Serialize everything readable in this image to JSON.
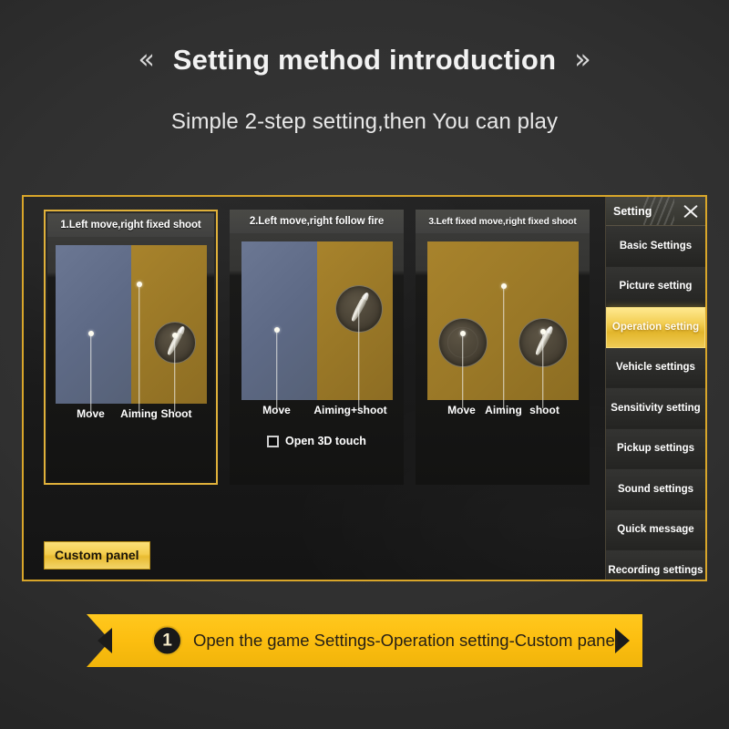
{
  "header": {
    "title": "Setting method introduction",
    "subtitle": "Simple 2-step setting,then You can play",
    "left_chevron": "«",
    "right_chevron": "»"
  },
  "panels": [
    {
      "title": "1.Left move,right fixed shoot",
      "selected": true,
      "layout": "split",
      "labels": [
        "Move",
        "Aiming",
        "Shoot"
      ]
    },
    {
      "title": "2.Left move,right follow fire",
      "selected": false,
      "layout": "split",
      "labels": [
        "Move",
        "Aiming+shoot"
      ],
      "checkbox": {
        "label": "Open 3D touch",
        "checked": false
      }
    },
    {
      "title": "3.Left fixed move,right fixed shoot",
      "selected": false,
      "layout": "full",
      "labels": [
        "Move",
        "Aiming",
        "shoot"
      ]
    }
  ],
  "custom_panel_button": "Custom panel",
  "sidebar": {
    "title": "Setting",
    "close_icon": "close-icon",
    "items": [
      {
        "label": "Basic Settings",
        "active": false
      },
      {
        "label": "Picture setting",
        "active": false
      },
      {
        "label": "Operation setting",
        "active": true
      },
      {
        "label": "Vehicle settings",
        "active": false
      },
      {
        "label": "Sensitivity setting",
        "active": false
      },
      {
        "label": "Pickup settings",
        "active": false
      },
      {
        "label": "Sound settings",
        "active": false
      },
      {
        "label": "Quick message",
        "active": false
      },
      {
        "label": "Recording settings",
        "active": false
      }
    ]
  },
  "step": {
    "number": "1",
    "text": "Open the game Settings-Operation setting-Custom panel"
  },
  "colors": {
    "gold": "#e0b13a",
    "gold_bright": "#fcbe10",
    "move_zone": "#5e6a86",
    "fire_zone": "#9a7827",
    "background": "#2d2d2d"
  }
}
